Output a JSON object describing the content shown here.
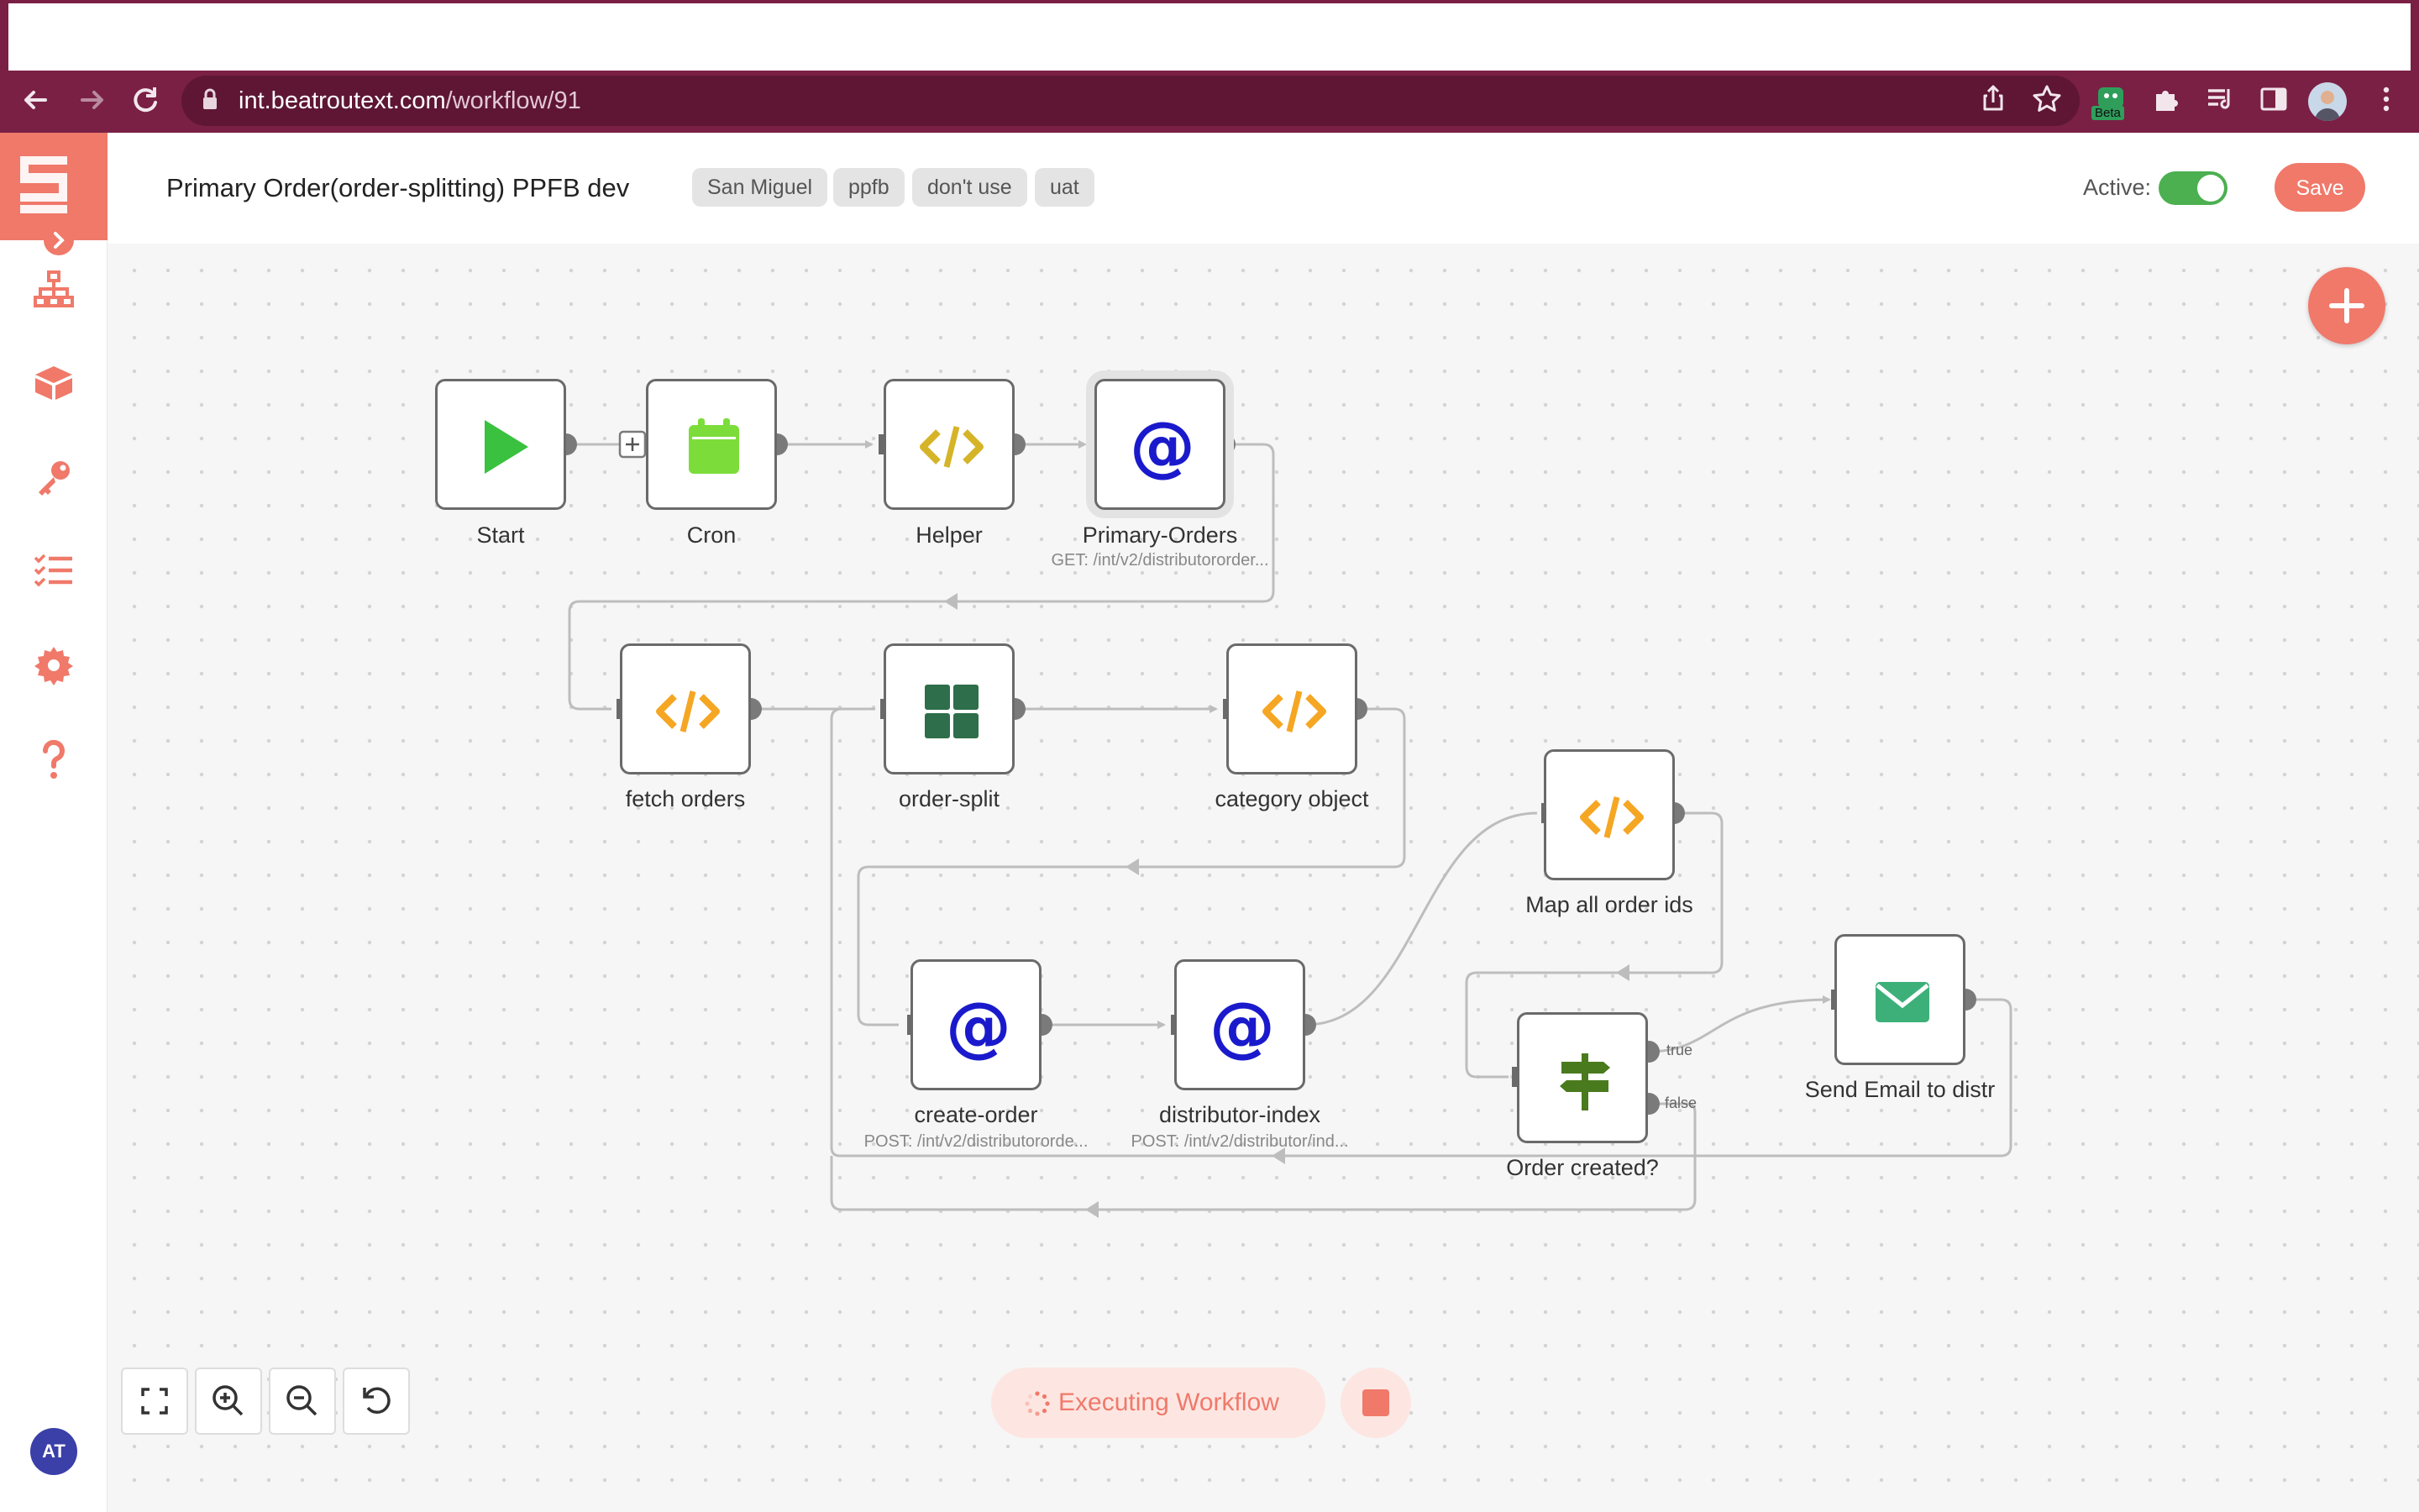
{
  "browser": {
    "url_domain": "int.beatroutext.com",
    "url_path": "/workflow/91",
    "beta_badge": "Beta"
  },
  "header": {
    "title": "Primary Order(order-splitting) PPFB dev",
    "tags": [
      "San Miguel",
      "ppfb",
      "don't use",
      "uat"
    ],
    "active_label": "Active:",
    "save_label": "Save"
  },
  "nodes": {
    "start": {
      "label": "Start"
    },
    "cron": {
      "label": "Cron"
    },
    "helper": {
      "label": "Helper"
    },
    "primary_orders": {
      "label": "Primary-Orders",
      "subtitle": "GET: /int/v2/distributororder..."
    },
    "fetch_orders": {
      "label": "fetch orders"
    },
    "order_split": {
      "label": "order-split"
    },
    "category_object": {
      "label": "category object"
    },
    "map_all_order_ids": {
      "label": "Map all order ids"
    },
    "create_order": {
      "label": "create-order",
      "subtitle": "POST: /int/v2/distributororde..."
    },
    "distributor_index": {
      "label": "distributor-index",
      "subtitle": "POST: /int/v2/distributor/ind..."
    },
    "order_created": {
      "label": "Order created?",
      "true_label": "true",
      "false_label": "false"
    },
    "send_email": {
      "label": "Send Email to distr"
    }
  },
  "footer": {
    "executing_label": "Executing Workflow"
  },
  "user": {
    "initials": "AT"
  },
  "colors": {
    "brand": "#f0796a",
    "browser_frame": "#7a2044",
    "toggle_on": "#4caf50",
    "code_icon": "#f5a623",
    "at_icon": "#1a1acc"
  }
}
